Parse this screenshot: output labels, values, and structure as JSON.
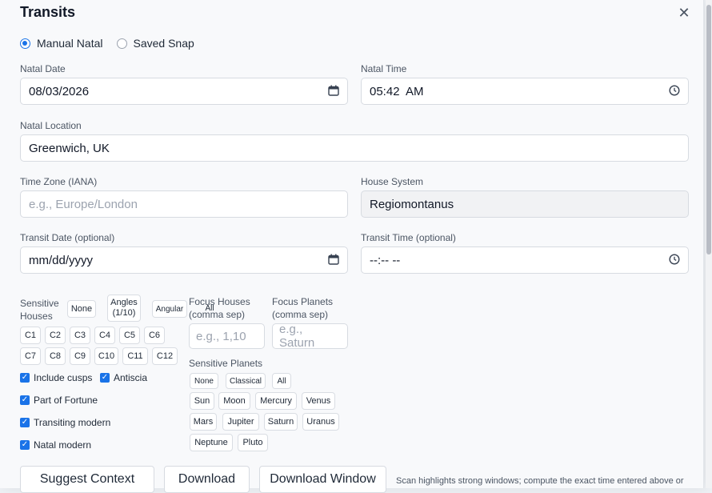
{
  "dialog": {
    "title": "Transits",
    "close_glyph": "✕"
  },
  "mode": {
    "options": [
      "Manual Natal",
      "Saved Snap"
    ],
    "selected": "Manual Natal"
  },
  "natal_date": {
    "label": "Natal Date",
    "value": "08/03/2026"
  },
  "natal_time": {
    "label": "Natal Time",
    "value": "05:42  AM"
  },
  "natal_location": {
    "label": "Natal Location",
    "value": "Greenwich, UK"
  },
  "time_zone": {
    "label": "Time Zone (IANA)",
    "placeholder": "e.g., Europe/London"
  },
  "house_system": {
    "label": "House System",
    "value": "Regiomontanus"
  },
  "transit_date": {
    "label": "Transit Date (optional)",
    "placeholder": "mm/dd/yyyy"
  },
  "transit_time": {
    "label": "Transit Time (optional)",
    "placeholder": "--:-- --"
  },
  "sensitive_houses": {
    "label": "Sensitive Houses",
    "presets": [
      "None",
      "Angles (1/10)",
      "Angular",
      "All"
    ],
    "cusps": [
      "C1",
      "C2",
      "C3",
      "C4",
      "C5",
      "C6",
      "C7",
      "C8",
      "C9",
      "C10",
      "C11",
      "C12"
    ]
  },
  "focus_houses": {
    "label": "Focus Houses (comma sep)",
    "placeholder": "e.g., 1,10"
  },
  "focus_planets": {
    "label": "Focus Planets (comma sep)",
    "placeholder": "e.g., Saturn"
  },
  "sensitive_planets": {
    "label": "Sensitive Planets",
    "presets": [
      "None",
      "Classical",
      "All"
    ],
    "planets": [
      "Sun",
      "Moon",
      "Mercury",
      "Venus",
      "Mars",
      "Jupiter",
      "Saturn",
      "Uranus",
      "Neptune",
      "Pluto"
    ]
  },
  "options": {
    "include_cusps": "Include cusps",
    "antiscia": "Antiscia",
    "part_of_fortune": "Part of Fortune",
    "transiting_modern": "Transiting modern",
    "natal_modern": "Natal modern"
  },
  "actions": {
    "suggest": "Suggest Context",
    "download": "Download",
    "download_window": "Download Window"
  },
  "hint": "Scan highlights strong windows; compute the exact time entered above or",
  "accent": "#1a73e8"
}
